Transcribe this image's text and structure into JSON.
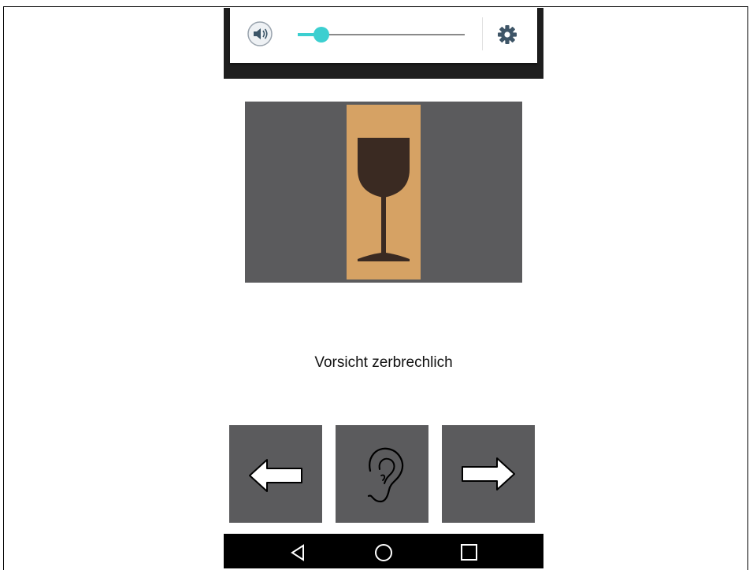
{
  "volume": {
    "level": 0.14,
    "accent_color": "#3ccfd0",
    "speaker_icon": "speaker-volume-icon",
    "settings_icon": "gear-icon"
  },
  "image": {
    "depicts": "fragile-glass-symbol",
    "panel_color": "#d6a264"
  },
  "caption": "Vorsicht zerbrechlich",
  "controls": {
    "previous_icon": "arrow-left-icon",
    "listen_icon": "ear-icon",
    "next_icon": "arrow-right-icon"
  },
  "navbar": {
    "back_icon": "triangle-back-icon",
    "home_icon": "circle-home-icon",
    "recents_icon": "square-recents-icon"
  }
}
